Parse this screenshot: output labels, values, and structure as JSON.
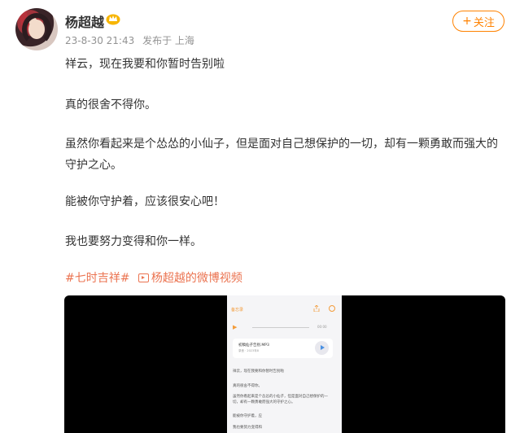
{
  "post": {
    "author": "杨超越",
    "timestamp": "23-8-30 21:43",
    "source": "发布于 上海",
    "follow_label": "关注",
    "follow_plus": "+",
    "paragraphs": [
      "祥云，现在我要和你暂时告别啦",
      "真的很舍不得你。",
      "虽然你看起来是个怂怂的小仙子，但是面对自己想保护的一切，却有一颗勇敢而强大的守护之心。",
      "能被你守护着，应该很安心吧！",
      "我也要努力变得和你一样。"
    ],
    "topic_tag": "#七时吉祥#",
    "video_link": "杨超越的微博视频"
  },
  "video_preview": {
    "back_label": "备忘录",
    "audio_time": "00:00",
    "file_name": "初稿仙子告别.MP3",
    "file_meta": "录音 · 2023年8",
    "note_lines": [
      "祥云，现在我要和你暂时告别啦",
      "真的很舍不得你。",
      "虽然你看起来是个怂怂的小仙子，但是面对自己想保护的一切，却有一颗勇敢而强大的守护之心。",
      "能被你守护着，应",
      "我也要努力变得和"
    ]
  },
  "colors": {
    "accent": "#ff8200",
    "link": "#eb7350",
    "meta": "#939393"
  }
}
